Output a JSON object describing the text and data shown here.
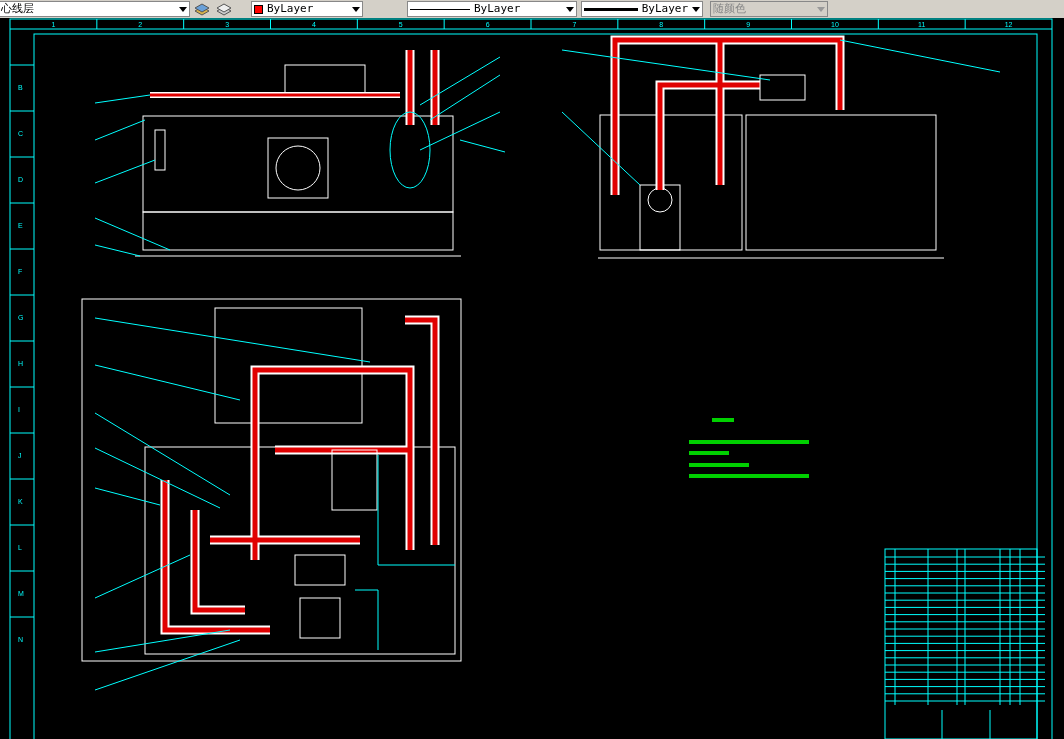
{
  "toolbar": {
    "layer": {
      "value": "心线层"
    },
    "color": {
      "value": "ByLayer",
      "color": "#ff0000"
    },
    "linetype": {
      "value": "ByLayer"
    },
    "lineweight": {
      "value": "ByLayer"
    },
    "plot_style": {
      "value": "随颜色",
      "disabled": true
    }
  },
  "drawing": {
    "column_labels": [
      "1",
      "2",
      "3",
      "4",
      "5",
      "6",
      "7",
      "8",
      "9",
      "10",
      "11",
      "12"
    ],
    "row_labels": [
      "B",
      "C",
      "D",
      "E",
      "F",
      "G",
      "H",
      "I",
      "J",
      "K",
      "L",
      "M",
      "N"
    ]
  }
}
